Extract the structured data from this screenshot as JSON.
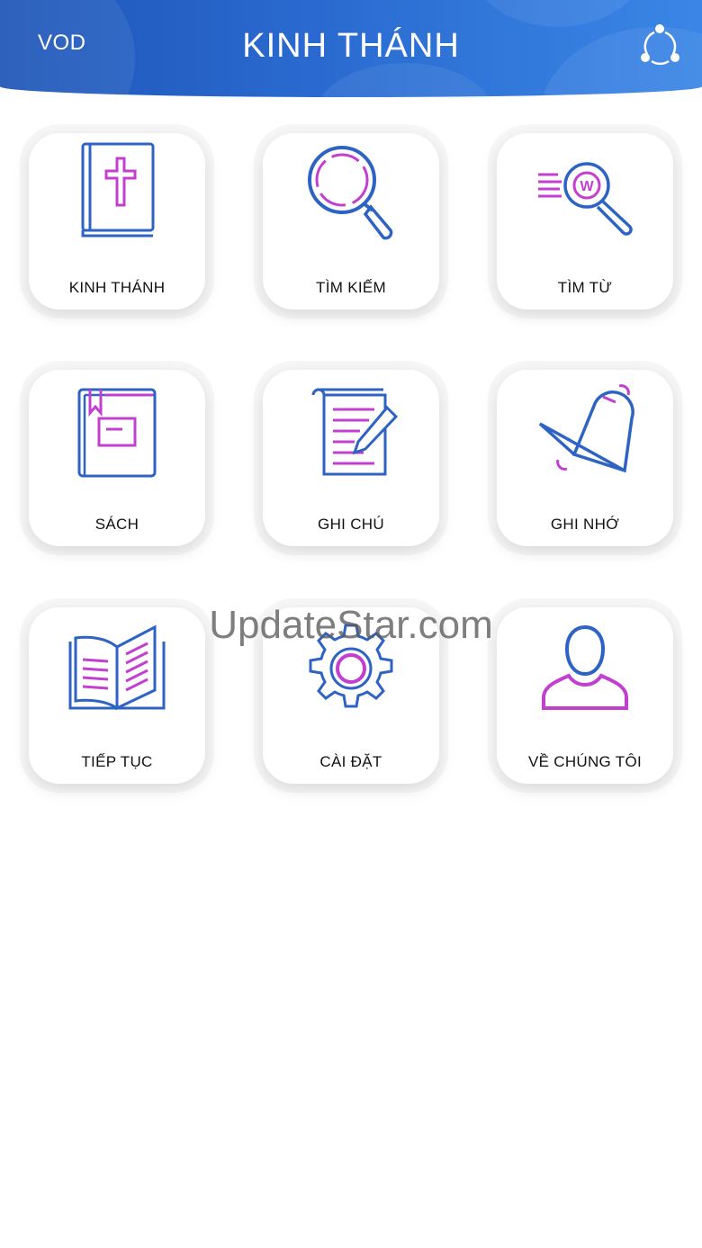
{
  "header": {
    "left_label": "VOD",
    "title": "KINH THÁNH",
    "share_icon": "share-icon",
    "color_start": "#1e56b8",
    "color_end": "#3a86e6"
  },
  "menu": [
    {
      "label": "KINH THÁNH",
      "icon": "bible-icon"
    },
    {
      "label": "TÌM KIẾM",
      "icon": "magnifier-icon"
    },
    {
      "label": "TÌM TỪ",
      "icon": "word-search-icon"
    },
    {
      "label": "SÁCH",
      "icon": "book-icon"
    },
    {
      "label": "GHI CHÚ",
      "icon": "notes-icon"
    },
    {
      "label": "GHI NHỚ",
      "icon": "bell-icon"
    },
    {
      "label": "TIẾP TỤC",
      "icon": "open-book-icon"
    },
    {
      "label": "CÀI ĐẶT",
      "icon": "gear-icon"
    },
    {
      "label": "VỀ CHÚNG TÔI",
      "icon": "user-icon"
    }
  ],
  "icon_colors": {
    "primary": "#2e63c4",
    "accent": "#c23fcf"
  },
  "watermark": "UpdateStar.com"
}
